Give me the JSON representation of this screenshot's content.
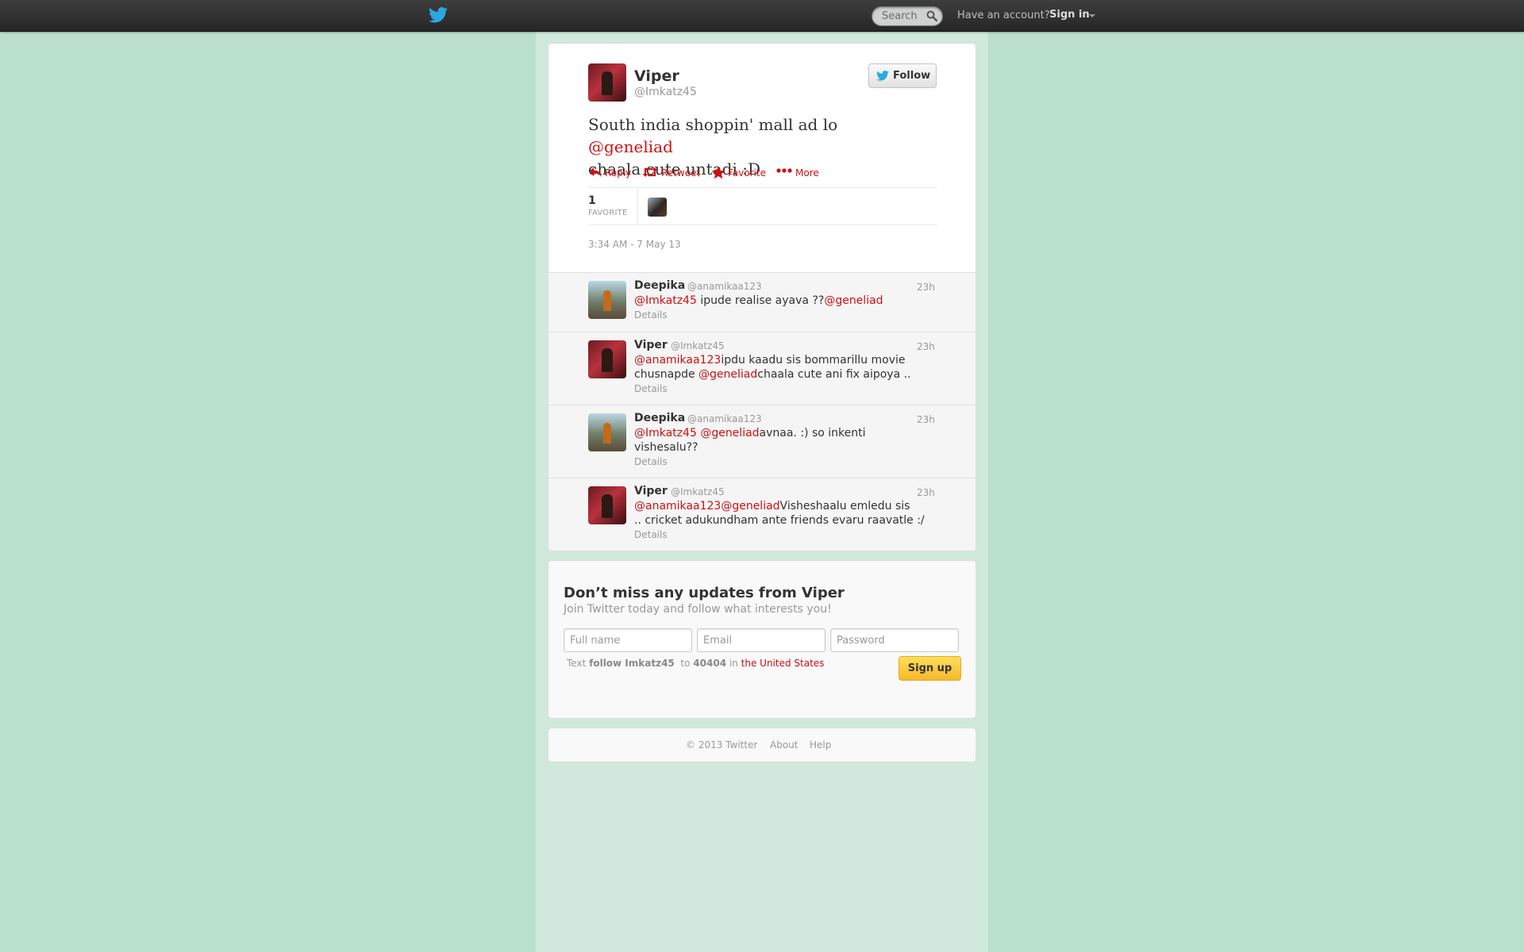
{
  "topbar": {
    "search_placeholder": "Search",
    "have_account": "Have an account?",
    "sign_in": "Sign in"
  },
  "tweet": {
    "author_name": "Viper",
    "author_handle": "@Imkatz45",
    "follow_label": "Follow",
    "text_before": "South india shoppin' mall ad lo ",
    "text_mention": "@geneliad",
    "text_after": "chaala cute untadi :D",
    "actions": {
      "reply": "Reply",
      "retweet": "Retweet",
      "favorite": "Favorite",
      "more": "More"
    },
    "favorite_count": "1",
    "favorite_label": "FAVORITE",
    "timestamp": "3:34 AM - 7 May 13"
  },
  "replies": [
    {
      "name": "Deepika",
      "handle": "@anamikaa123",
      "time": "23h",
      "line1": [
        {
          "t": "@Imkatz45",
          "link": true
        },
        {
          "t": " ipude realise ayava ??",
          "link": false
        },
        {
          "t": "@geneliad",
          "link": true
        }
      ],
      "line2": [],
      "details": "Details"
    },
    {
      "name": "Viper",
      "handle": "@Imkatz45",
      "time": "23h",
      "line1": [
        {
          "t": "@anamikaa123",
          "link": true
        },
        {
          "t": "ipdu kaadu sis bommarillu movie",
          "link": false
        }
      ],
      "line2": [
        {
          "t": "chusnapde ",
          "link": false
        },
        {
          "t": "@geneliad",
          "link": true
        },
        {
          "t": "chaala cute ani fix aipoya ..",
          "link": false
        }
      ],
      "details": "Details"
    },
    {
      "name": "Deepika",
      "handle": "@anamikaa123",
      "time": "23h",
      "line1": [
        {
          "t": "@Imkatz45",
          "link": true
        },
        {
          "t": " ",
          "link": false
        },
        {
          "t": "@geneliad",
          "link": true
        },
        {
          "t": "avnaa. :) so inkenti",
          "link": false
        }
      ],
      "line2": [
        {
          "t": "vishesalu??",
          "link": false
        }
      ],
      "details": "Details"
    },
    {
      "name": "Viper",
      "handle": "@Imkatz45",
      "time": "23h",
      "line1": [
        {
          "t": "@anamikaa123",
          "link": true
        },
        {
          "t": "@geneliad",
          "link": true
        },
        {
          "t": "Visheshaalu emledu sis",
          "link": false
        }
      ],
      "line2": [
        {
          "t": ".. cricket adukundham ante friends evaru raavatle :/",
          "link": false
        }
      ],
      "details": "Details"
    }
  ],
  "signup": {
    "title": "Don’t miss any updates from Viper",
    "subtitle": "Join Twitter today and follow what interests you!",
    "fullname_placeholder": "Full name",
    "email_placeholder": "Email",
    "password_placeholder": "Password",
    "text_label": "Text",
    "follow_cmd": "follow Imkatz45",
    "to_label": "to",
    "shortcode": "40404",
    "in_label": "in",
    "country": "the United States",
    "button": "Sign up"
  },
  "footer": {
    "copyright": "© 2013 Twitter",
    "about": "About",
    "help": "Help"
  }
}
